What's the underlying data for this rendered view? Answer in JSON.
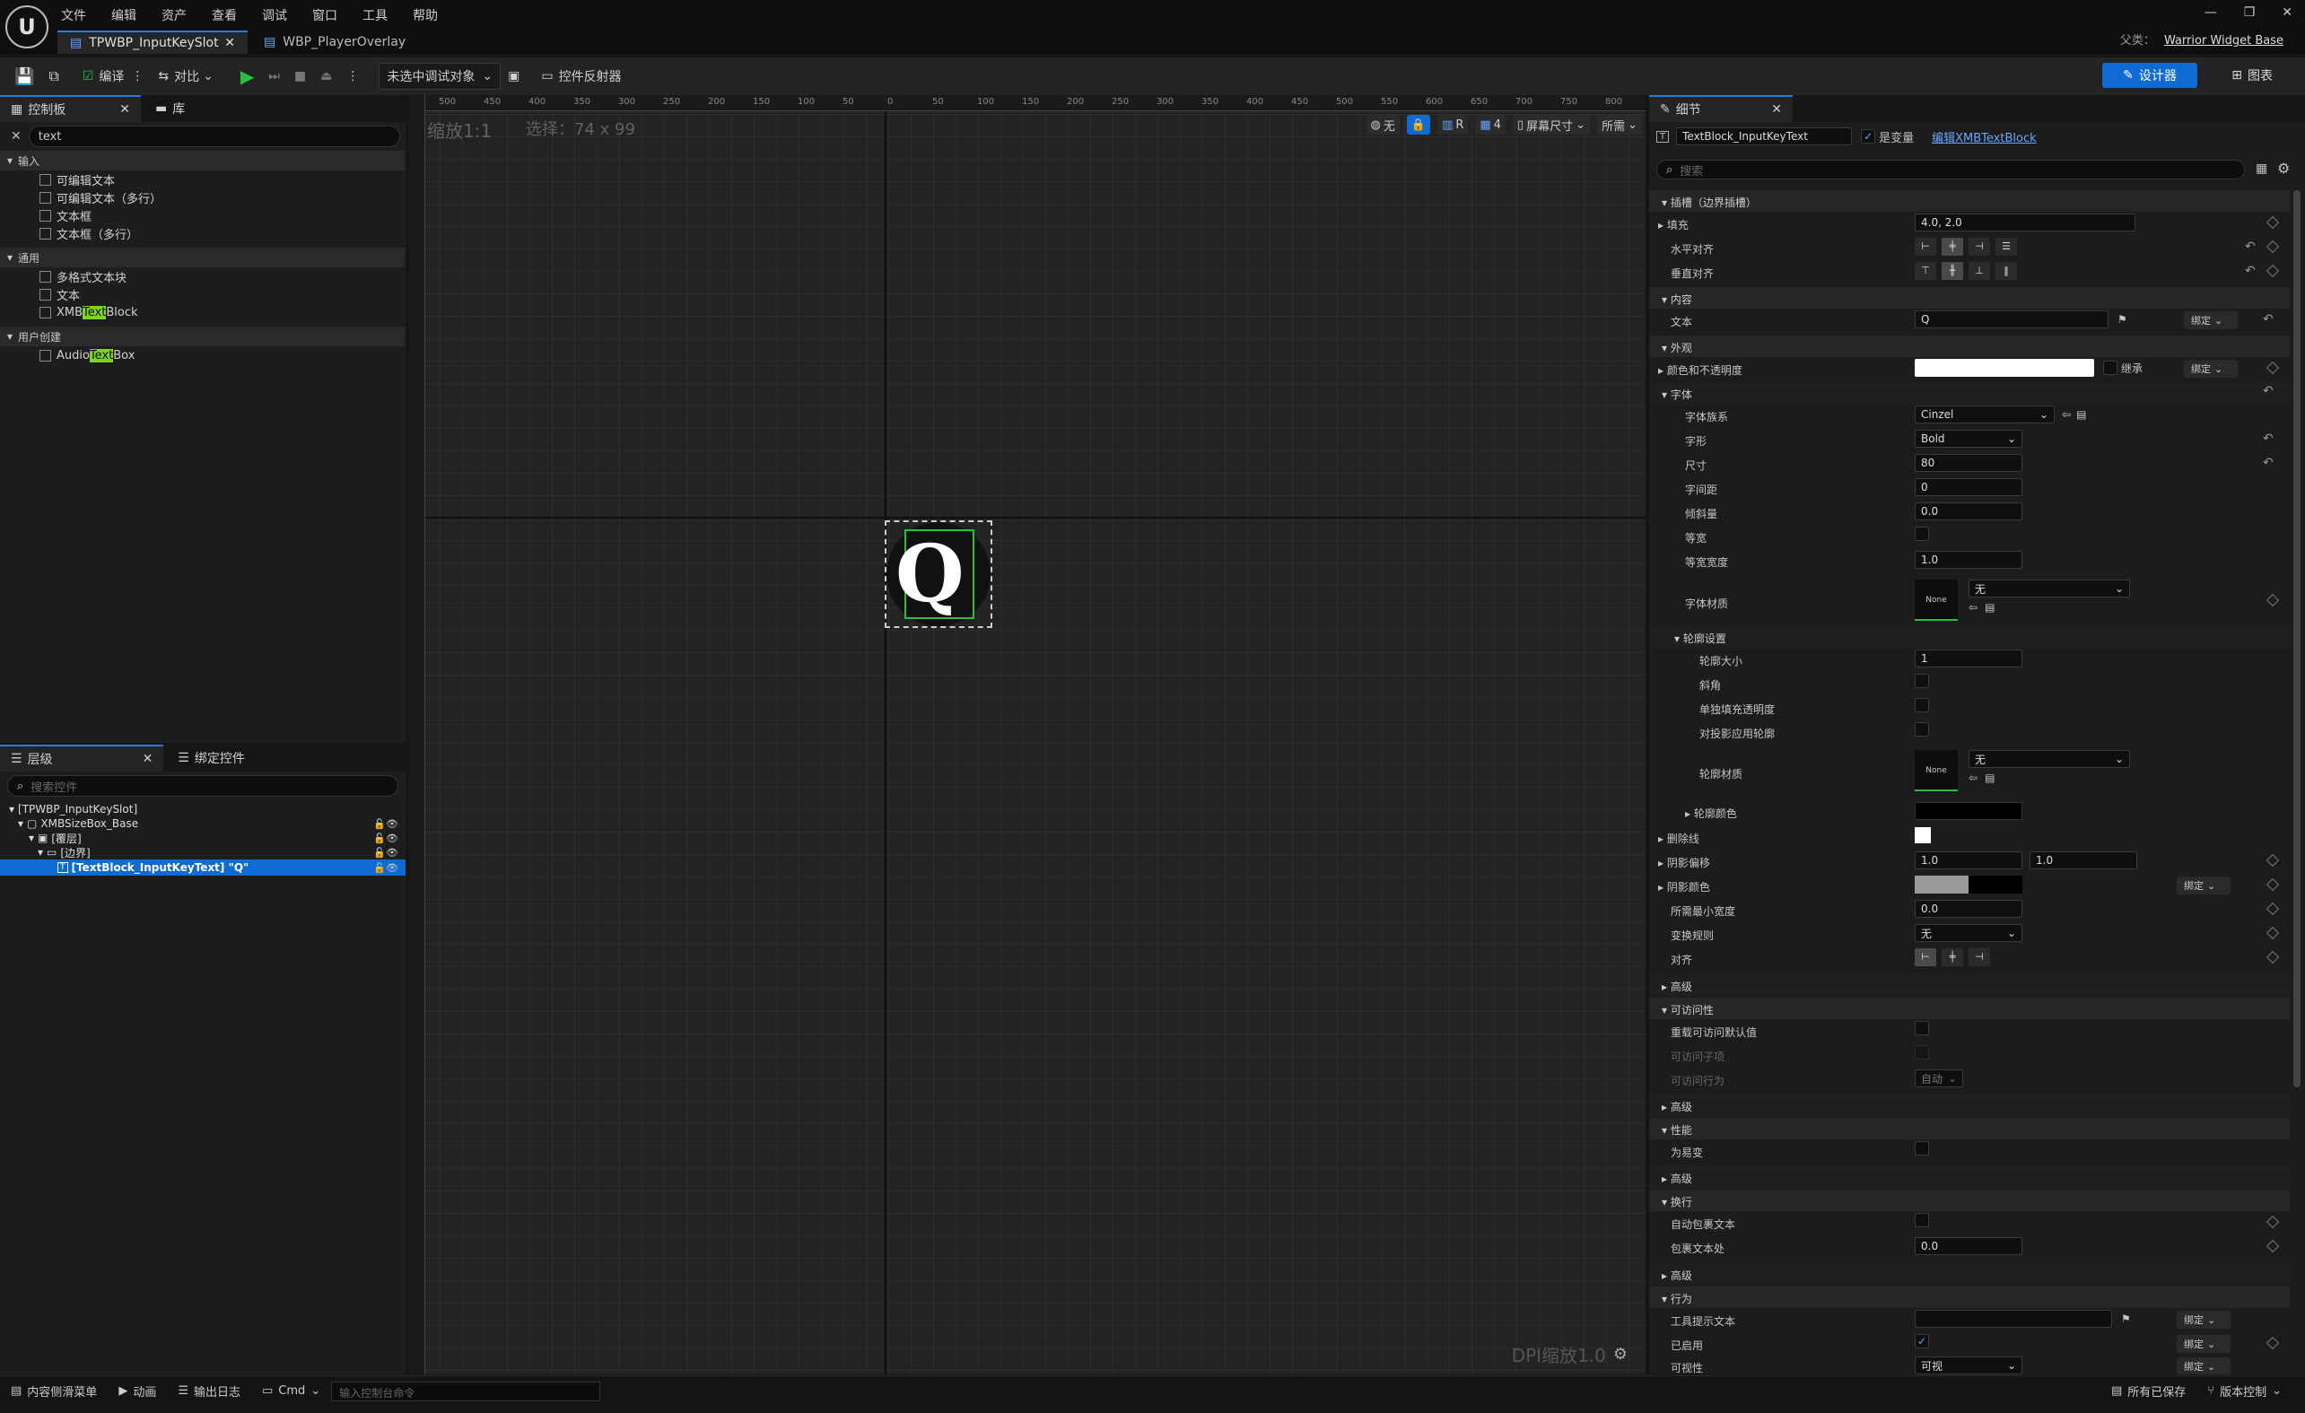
{
  "titlebar": {
    "logo": "U",
    "menu": [
      "文件",
      "编辑",
      "资产",
      "查看",
      "调试",
      "窗口",
      "工具",
      "帮助"
    ],
    "tabs": [
      "TPWBP_InputKeySlot",
      "WBP_PlayerOverlay"
    ],
    "parent_label": "父类：",
    "parent_value": "Warrior Widget Base"
  },
  "toolbar": {
    "compile": "编译",
    "diff": "对比",
    "debug_target": "未选中调试对象",
    "reflector": "控件反射器",
    "designer": "设计器",
    "graph": "图表"
  },
  "palette": {
    "tab_palette": "控制板",
    "tab_library": "库",
    "search_value": "text",
    "categories": [
      {
        "name": "输入",
        "items": [
          "可编辑文本",
          "可编辑文本（多行）",
          "文本框",
          "文本框（多行）"
        ]
      },
      {
        "name": "通用",
        "items": [
          "多格式文本块",
          "文本"
        ]
      },
      {
        "name": "用户创建",
        "items": []
      }
    ],
    "xmb_pre": "XMB",
    "xmb_hl": "Text",
    "xmb_post": "Block",
    "audio_pre": "Audio ",
    "audio_hl": "Text",
    "audio_post": " Box"
  },
  "hierarchy": {
    "tab_hierarchy": "层级",
    "tab_bind": "绑定控件",
    "search_placeholder": "搜索控件",
    "rows": [
      "[TPWBP_InputKeySlot]",
      "XMBSizeBox_Base",
      "[覆层]",
      "[边界]",
      "[TextBlock_InputKeyText] \"Q\""
    ]
  },
  "viewport": {
    "zoom": "缩放1:1",
    "selection": "选择：74 x 99",
    "ruler_ticks": [
      "500",
      "450",
      "400",
      "350",
      "300",
      "250",
      "200",
      "150",
      "100",
      "50",
      "0",
      "50",
      "100",
      "150",
      "200",
      "250",
      "300",
      "350",
      "400",
      "450",
      "500",
      "550",
      "600",
      "650",
      "700",
      "750",
      "800"
    ],
    "widget_text": "Q",
    "tools": [
      "无",
      "R",
      "4",
      "屏幕尺寸",
      "所需"
    ],
    "dpi": "DPI缩放1.0"
  },
  "details": {
    "tab": "细节",
    "widget_name": "TextBlock_InputKeyText",
    "is_variable": "是变量",
    "edit_link": "编辑XMBTextBlock",
    "search_placeholder": "搜索",
    "slot_cat": "插槽（边界插槽）",
    "padding_label": "填充",
    "padding_value": "4.0, 2.0",
    "halign_label": "水平对齐",
    "valign_label": "垂直对齐",
    "content_cat": "内容",
    "text_label": "文本",
    "text_value": "Q",
    "bind": "绑定",
    "appearance_cat": "外观",
    "color_label": "颜色和不透明度",
    "inherit": "继承",
    "font_cat": "字体",
    "font_family_label": "字体族系",
    "font_family_value": "Cinzel",
    "typeface_label": "字形",
    "typeface_value": "Bold",
    "size_label": "尺寸",
    "size_value": "80",
    "spacing_label": "字间距",
    "spacing_value": "0",
    "skew_label": "倾斜量",
    "skew_value": "0.0",
    "mono_label": "等宽",
    "mono_width_label": "等宽宽度",
    "mono_width_value": "1.0",
    "font_material_label": "字体材质",
    "none": "None",
    "none_cn": "无",
    "outline_cat": "轮廓设置",
    "outline_size_label": "轮廓大小",
    "outline_size_value": "1",
    "miter_label": "斜角",
    "sep_fill_label": "单独填充透明度",
    "apply_shadow_label": "对投影应用轮廓",
    "outline_material_label": "轮廓材质",
    "outline_color_label": "轮廓颜色",
    "strike_label": "删除线",
    "shadow_offset_label": "阴影偏移",
    "shadow_offset_x": "1.0",
    "shadow_offset_y": "1.0",
    "shadow_color_label": "阴影颜色",
    "min_width_label": "所需最小宽度",
    "min_width_value": "0.0",
    "transform_label": "变换规则",
    "transform_value": "无",
    "justify_label": "对齐",
    "advanced": "高级",
    "access_cat": "可访问性",
    "override_access_label": "重载可访问默认值",
    "access_children_label": "可访问子项",
    "access_behavior_label": "可访问行为",
    "access_behavior_value": "自动",
    "perf_cat": "性能",
    "volatile_label": "为易变",
    "wrap_cat": "换行",
    "autowrap_label": "自动包裹文本",
    "wrap_at_label": "包裹文本处",
    "wrap_at_value": "0.0",
    "behavior_cat": "行为",
    "tooltip_label": "工具提示文本",
    "enabled_label": "已启用",
    "visibility_label": "可视性",
    "visibility_value": "可视"
  },
  "statusbar": {
    "content_drawer": "内容侧滑菜单",
    "anim": "动画",
    "output_log": "输出日志",
    "cmd": "Cmd",
    "console_placeholder": "输入控制台命令",
    "all_saved": "所有已保存",
    "source_control": "版本控制"
  },
  "colors": {
    "accent": "#0f6bd2",
    "highlight": "#7dd327",
    "selection_green": "#29c040"
  }
}
